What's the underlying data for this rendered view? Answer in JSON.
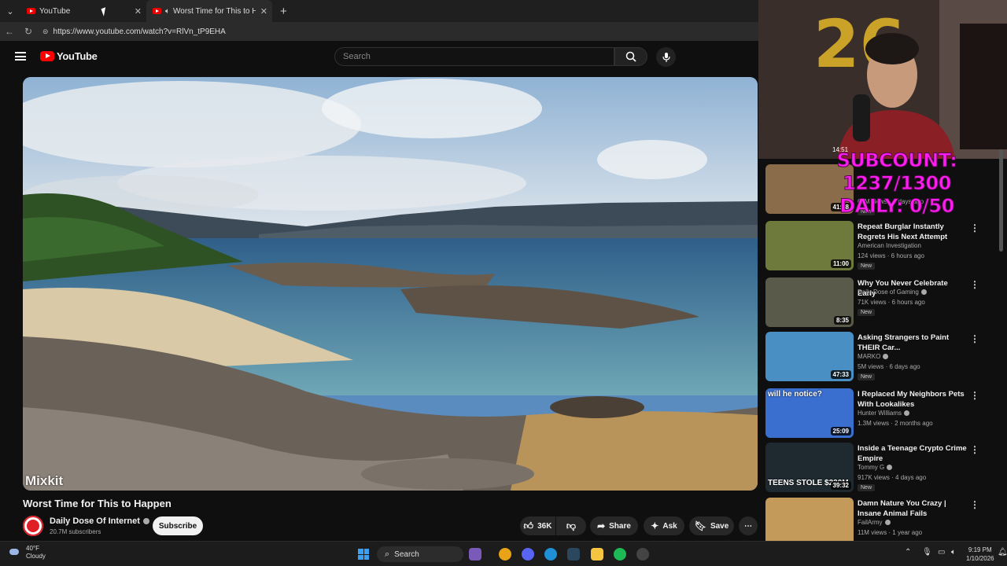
{
  "browser": {
    "tabs": [
      {
        "title": "YouTube"
      },
      {
        "title": "Worst Time for This to Happe"
      }
    ],
    "url": "https://www.youtube.com/watch?v=RlVn_tP9EHA"
  },
  "youtube": {
    "logo_text": "YouTube",
    "search_placeholder": "Search",
    "player_watermark": "Mixkit",
    "video_title": "Worst Time for This to Happen",
    "channel_name": "Daily Dose Of Internet",
    "subscribers": "20.7M subscribers",
    "subscribe_label": "Subscribe",
    "like_count": "36K",
    "share_label": "Share",
    "ask_label": "Ask",
    "save_label": "Save"
  },
  "overlay": {
    "subcount_line1": "SUBCOUNT: 1237/1300",
    "subcount_line2": "DAILY: 0/50",
    "clock": "14:51"
  },
  "recommendations": [
    {
      "title": "",
      "channel": "",
      "meta": "62M views · 3 days ago",
      "badge": "New",
      "duration": "41:58",
      "thumb_color": "#8a6b4a"
    },
    {
      "title": "Repeat Burglar Instantly Regrets His Next Attempt",
      "channel": "American Investigation",
      "meta": "124 views · 6 hours ago",
      "badge": "New",
      "duration": "11:00",
      "thumb_color": "#6d7a3c"
    },
    {
      "title": "Why You Never Celebrate Early",
      "channel": "Daily Dose of Gaming",
      "meta": "71K views · 6 hours ago",
      "badge": "New",
      "duration": "8:35",
      "thumb_color": "#5a5a4a"
    },
    {
      "title": "Asking Strangers to Paint THEIR Car...",
      "channel": "MARKO",
      "meta": "5M views · 6 days ago",
      "badge": "New",
      "duration": "47:33",
      "thumb_color": "#4a8fc4"
    },
    {
      "title": "I Replaced My Neighbors Pets With Lookalikes",
      "channel": "Hunter Williams",
      "meta": "1.3M views · 2 months ago",
      "badge": "",
      "duration": "25:09",
      "thumb_color": "#3a6fd0",
      "thumb_text": "will he    notice?"
    },
    {
      "title": "Inside a Teenage Crypto Crime Empire",
      "channel": "Tommy G",
      "meta": "917K views · 4 days ago",
      "badge": "New",
      "duration": "39:32",
      "thumb_color": "#1f2a30",
      "thumb_text": "TEENS STOLE $230M"
    },
    {
      "title": "Damn Nature You Crazy | Insane Animal Fails",
      "channel": "FailArmy",
      "meta": "11M views · 1 year ago",
      "badge": "",
      "duration": "",
      "thumb_color": "#c49a5a"
    }
  ],
  "taskbar": {
    "weather_temp": "40°F",
    "weather_desc": "Cloudy",
    "search_label": "Search",
    "time": "9:19 PM",
    "date": "1/10/2026"
  }
}
